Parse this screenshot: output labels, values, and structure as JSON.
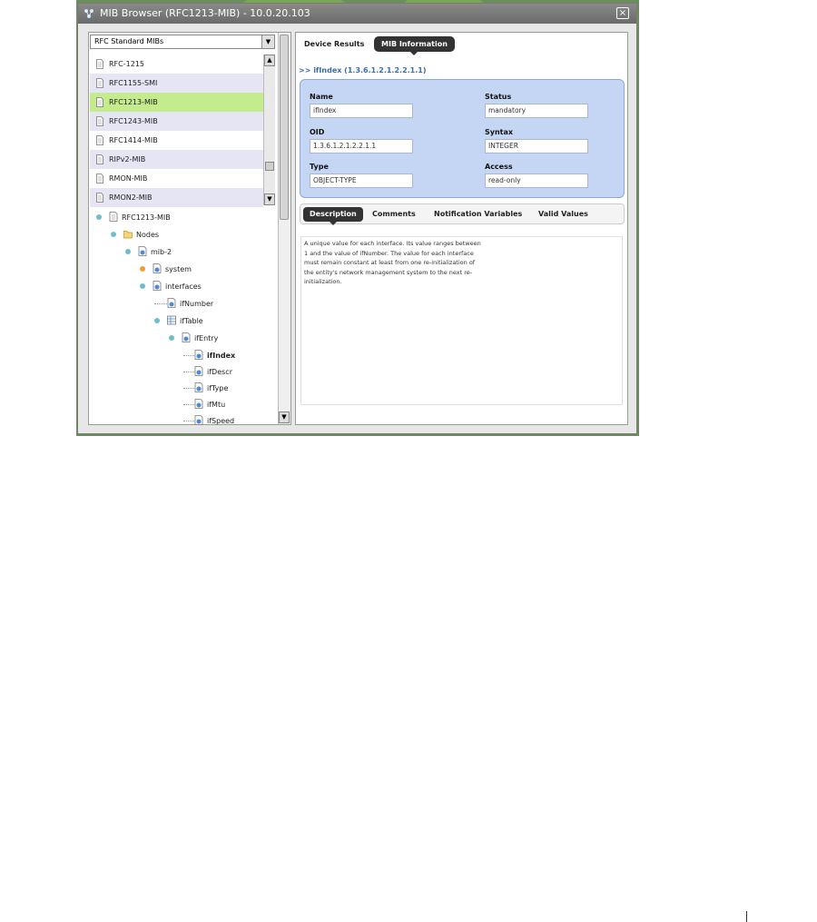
{
  "window": {
    "title": "MIB Browser (RFC1213-MIB) - 10.0.20.103",
    "close_label": "×"
  },
  "left_panel": {
    "mib_category": "RFC Standard MIBs",
    "mib_list": [
      {
        "label": "RFC-1215"
      },
      {
        "label": "RFC1155-SMI"
      },
      {
        "label": "RFC1213-MIB",
        "selected": true
      },
      {
        "label": "RFC1243-MIB"
      },
      {
        "label": "RFC1414-MIB"
      },
      {
        "label": "RIPv2-MIB"
      },
      {
        "label": "RMON-MIB"
      },
      {
        "label": "RMON2-MIB"
      }
    ],
    "tree": {
      "root": "RFC1213-MIB",
      "nodes": "Nodes",
      "mib2": "mib-2",
      "system": "system",
      "interfaces": "interfaces",
      "ifNumber": "ifNumber",
      "ifTable": "ifTable",
      "ifEntry": "ifEntry",
      "ifIndex": "ifIndex",
      "ifDescr": "ifDescr",
      "ifType": "ifType",
      "ifMtu": "ifMtu",
      "ifSpeed": "ifSpeed"
    }
  },
  "right_panel": {
    "tabs": {
      "device_results": "Device Results",
      "mib_information": "MIB Information"
    },
    "oid_heading": ">> ifIndex (1.3.6.1.2.1.2.2.1.1)",
    "fields": {
      "name_label": "Name",
      "name_value": "ifIndex",
      "status_label": "Status",
      "status_value": "mandatory",
      "oid_label": "OID",
      "oid_value": "1.3.6.1.2.1.2.2.1.1",
      "syntax_label": "Syntax",
      "syntax_value": "INTEGER",
      "type_label": "Type",
      "type_value": "OBJECT-TYPE",
      "access_label": "Access",
      "access_value": "read-only"
    },
    "subtabs": {
      "description": "Description",
      "comments": "Comments",
      "notification_variables": "Notification Variables",
      "valid_values": "Valid Values"
    },
    "description_text": "A unique value for each interface. Its value ranges between 1 and the value of ifNumber. The value for each interface must remain constant at least from one re-initialization of the entity's network management system to the next re-initialization."
  },
  "colors": {
    "selected_row": "#c5ec8c",
    "info_panel": "#c5d6f5",
    "active_tab": "#333333",
    "oid_heading": "#3a6ea8"
  }
}
